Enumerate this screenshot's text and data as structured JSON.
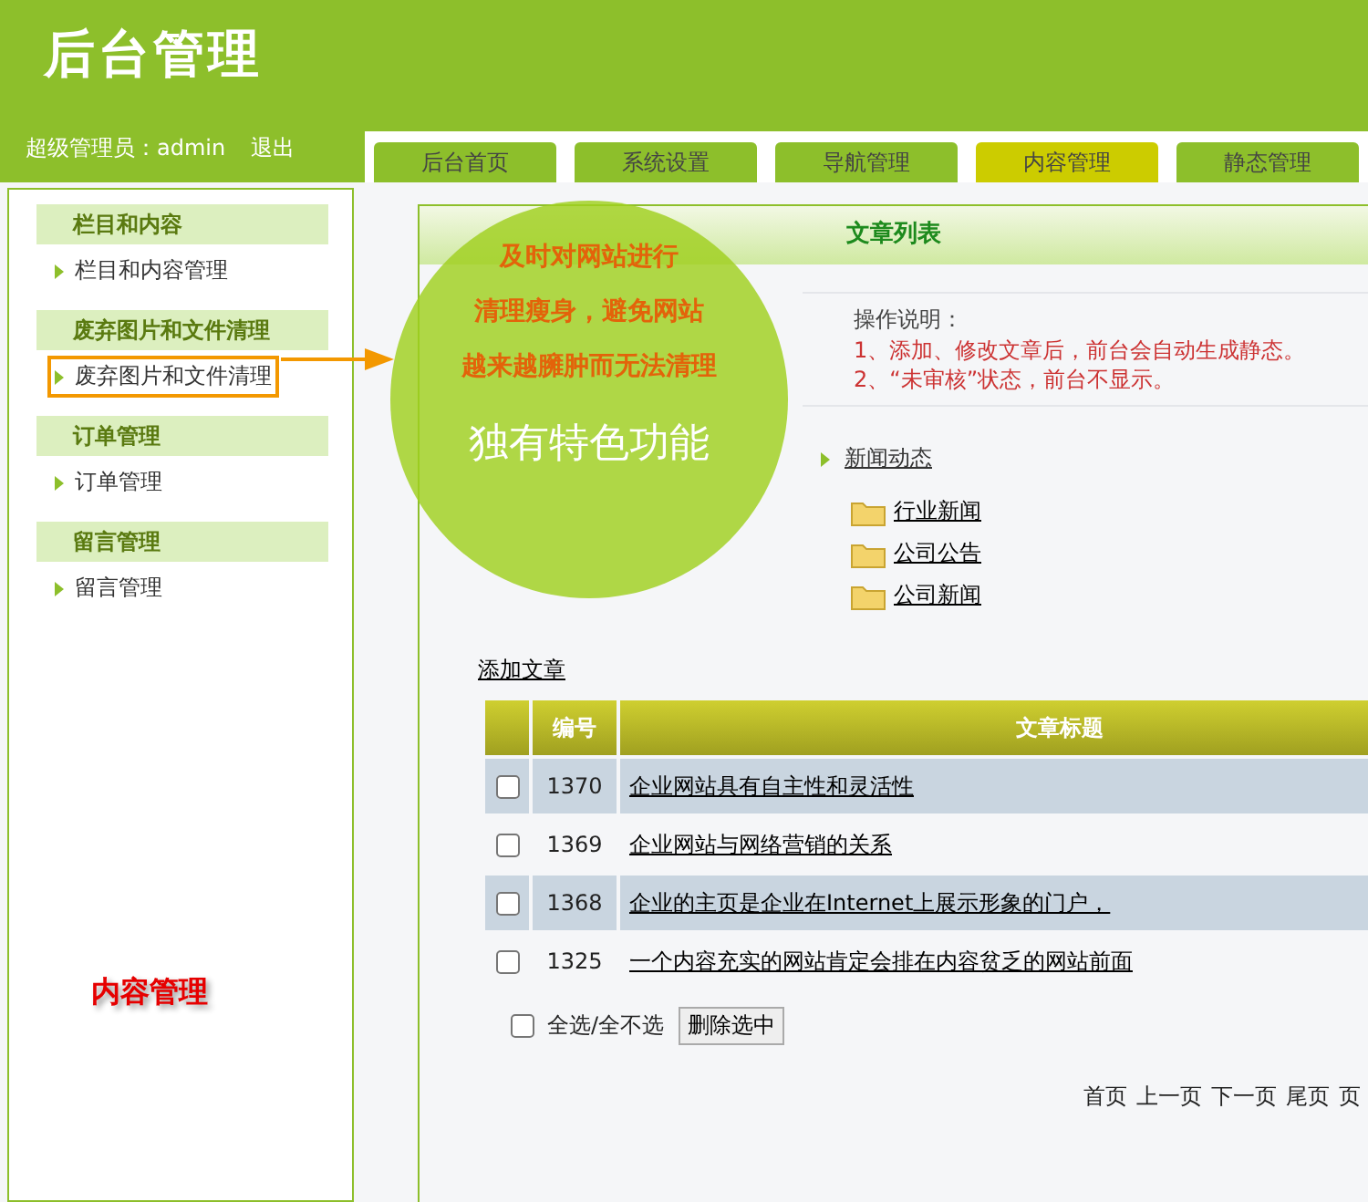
{
  "header": {
    "logo": "后台管理",
    "user_label": "超级管理员：admin",
    "logout": "退出"
  },
  "tabs": [
    {
      "label": "后台首页",
      "selected": false
    },
    {
      "label": "系统设置",
      "selected": false
    },
    {
      "label": "导航管理",
      "selected": false
    },
    {
      "label": "内容管理",
      "selected": true
    },
    {
      "label": "静态管理",
      "selected": false
    }
  ],
  "sidebar": {
    "groups": [
      {
        "title": "栏目和内容",
        "items": [
          {
            "label": "栏目和内容管理",
            "highlighted": false
          }
        ]
      },
      {
        "title": "废弃图片和文件清理",
        "items": [
          {
            "label": "废弃图片和文件清理",
            "highlighted": true
          }
        ]
      },
      {
        "title": "订单管理",
        "items": [
          {
            "label": "订单管理",
            "highlighted": false
          }
        ]
      },
      {
        "title": "留言管理",
        "items": [
          {
            "label": "留言管理",
            "highlighted": false
          }
        ]
      }
    ],
    "section_label": "内容管理"
  },
  "panel": {
    "title": "文章列表",
    "instructions_title": "操作说明：",
    "instructions": [
      "1、添加、修改文章后，前台会自动生成静态。",
      "2、“未审核”状态，前台不显示。"
    ],
    "tree": [
      {
        "label": "新闻动态",
        "children": [
          {
            "label": "行业新闻"
          },
          {
            "label": "公司公告"
          },
          {
            "label": "公司新闻"
          }
        ]
      }
    ],
    "add_link": "添加文章",
    "table": {
      "columns": [
        "编号",
        "文章标题"
      ],
      "rows": [
        {
          "checked": false,
          "id": "1370",
          "title": "企业网站具有自主性和灵活性"
        },
        {
          "checked": false,
          "id": "1369",
          "title": "企业网站与网络营销的关系"
        },
        {
          "checked": false,
          "id": "1368",
          "title": "企业的主页是企业在Internet上展示形象的门户，"
        },
        {
          "checked": false,
          "id": "1325",
          "title": "一个内容充实的网站肯定会排在内容贫乏的网站前面"
        }
      ]
    },
    "select_all": {
      "label": "全选/全不选",
      "checked": false
    },
    "delete_button": "删除选中",
    "pagination": [
      "首页",
      "上一页",
      "下一页",
      "尾页",
      "页"
    ]
  },
  "callout": {
    "lines": [
      "及时对网站进行",
      "清理瘦身，避免网站",
      "越来越臃肿而无法清理"
    ],
    "title": "独有特色功能"
  }
}
